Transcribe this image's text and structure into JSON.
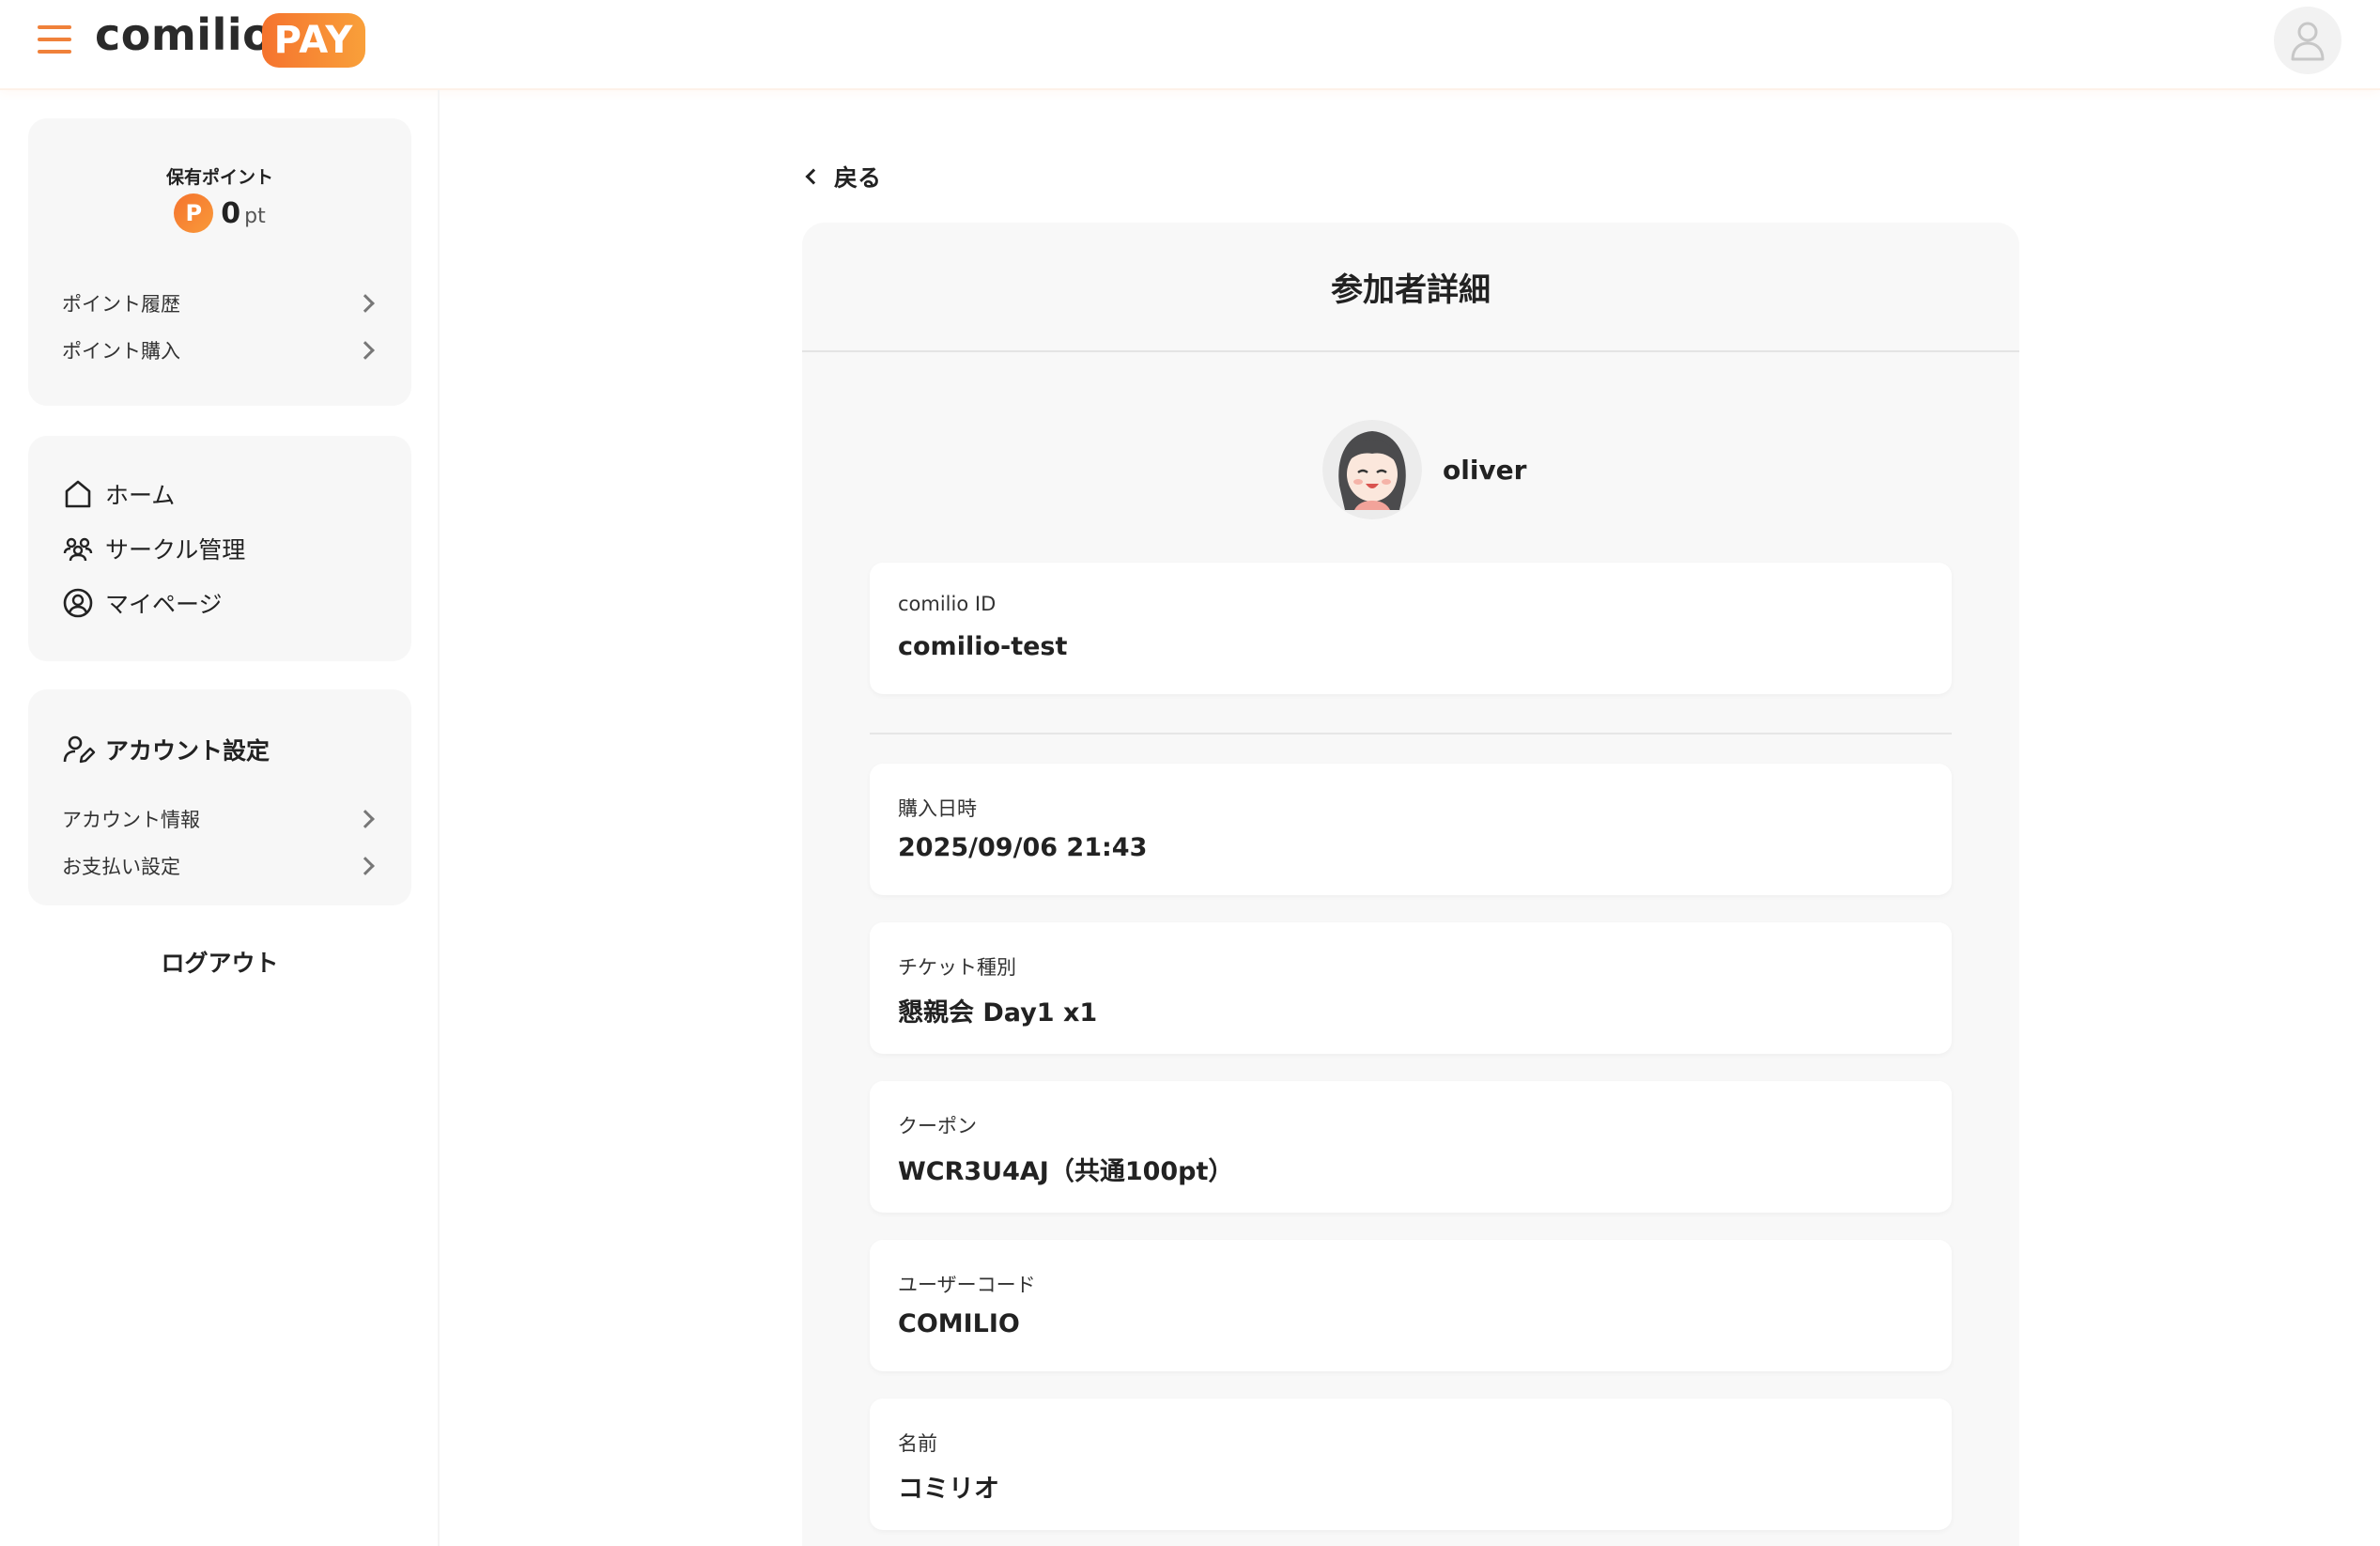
{
  "header": {
    "logo_text": "comilio",
    "logo_badge": "PAY"
  },
  "sidebar": {
    "points": {
      "title": "保有ポイント",
      "icon_letter": "P",
      "value": "0",
      "unit": "pt",
      "links": [
        {
          "label": "ポイント履歴"
        },
        {
          "label": "ポイント購入"
        }
      ]
    },
    "nav": [
      {
        "label": "ホーム",
        "icon": "home-icon"
      },
      {
        "label": "サークル管理",
        "icon": "users-icon"
      },
      {
        "label": "マイページ",
        "icon": "user-circle-icon"
      }
    ],
    "account": {
      "title": "アカウント設定",
      "links": [
        {
          "label": "アカウント情報"
        },
        {
          "label": "お支払い設定"
        }
      ]
    },
    "logout": "ログアウト"
  },
  "main": {
    "back_label": "戻る",
    "title": "参加者詳細",
    "user": {
      "name": "oliver"
    },
    "id_field": {
      "label": "comilio ID",
      "value": "comilio-test"
    },
    "fields": [
      {
        "label": "購入日時",
        "value": "2025/09/06 21:43"
      },
      {
        "label": "チケット種別",
        "value": "懇親会 Day1 x1"
      },
      {
        "label": "クーポン",
        "value": "WCR3U4AJ（共通100pt）"
      },
      {
        "label": "ユーザーコード",
        "value": "COMILIO"
      },
      {
        "label": "名前",
        "value": "コミリオ"
      }
    ]
  },
  "colors": {
    "accent": "#f0813a",
    "panel_bg": "#f8f8f8",
    "card_bg": "#f7f7f7"
  }
}
